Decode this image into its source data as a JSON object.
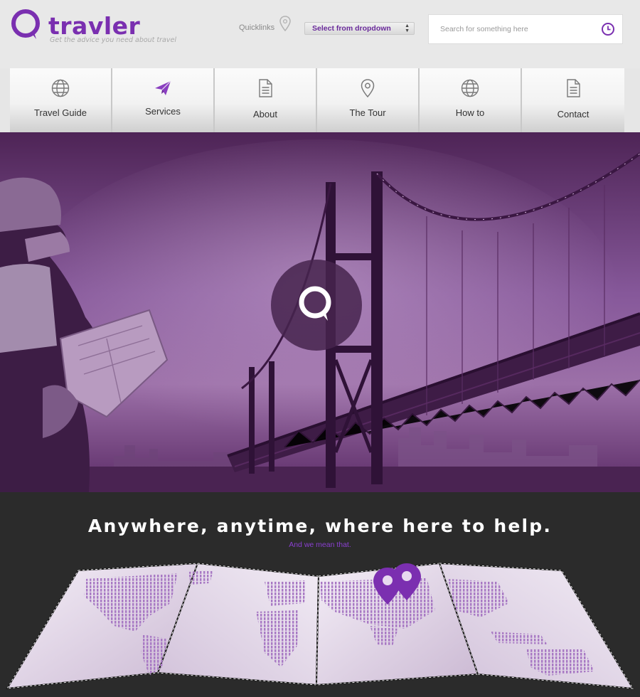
{
  "brand": {
    "name": "travler",
    "tagline": "Get the advice you need about travel",
    "color": "#7a2fb0"
  },
  "header": {
    "quicklinks_label": "Quicklinks",
    "dropdown_value": "Select from dropdown",
    "search_placeholder": "Search for something here"
  },
  "nav": {
    "items": [
      {
        "label": "Travel Guide",
        "icon": "globe-icon"
      },
      {
        "label": "Services",
        "icon": "paper-plane-icon"
      },
      {
        "label": "About",
        "icon": "document-icon"
      },
      {
        "label": "The Tour",
        "icon": "map-pin-icon"
      },
      {
        "label": "How to",
        "icon": "globe-icon"
      },
      {
        "label": "Contact",
        "icon": "document-icon"
      }
    ]
  },
  "hero": {
    "overlay_color": "#7b3f8c"
  },
  "band": {
    "title": "Anywhere, anytime, where here to help.",
    "subtitle": "And we mean that."
  }
}
